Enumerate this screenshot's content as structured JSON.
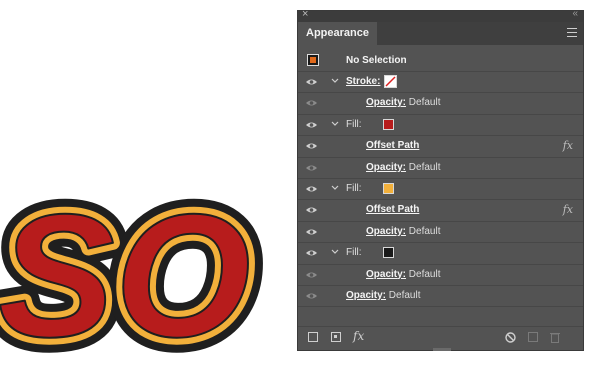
{
  "artwork": {
    "text": "SO",
    "colors": {
      "outer": "#1f1f1f",
      "gold": "#f2b03b",
      "red": "#b71c1c"
    }
  },
  "panel": {
    "title": "Appearance",
    "colors": {
      "bg": "#535353",
      "dark": "#3c3c3c",
      "text": "#ededed"
    },
    "selection": {
      "label": "No Selection"
    },
    "rows": {
      "stroke": {
        "label": "Stroke:"
      },
      "stroke_opacity": {
        "label": "Opacity:",
        "value": "Default"
      },
      "fill1": {
        "label": "Fill:",
        "swatch": "#b71c1c"
      },
      "fill1_effect": {
        "label": "Offset Path",
        "fx": "fx"
      },
      "fill1_opacity": {
        "label": "Opacity:",
        "value": "Default"
      },
      "fill2": {
        "label": "Fill:",
        "swatch": "#f2b03b"
      },
      "fill2_effect": {
        "label": "Offset Path",
        "fx": "fx"
      },
      "fill2_opacity": {
        "label": "Opacity:",
        "value": "Default"
      },
      "fill3": {
        "label": "Fill:",
        "swatch": "#1a1a1a"
      },
      "fill3_opacity": {
        "label": "Opacity:",
        "value": "Default"
      },
      "opacity": {
        "label": "Opacity:",
        "value": "Default"
      }
    },
    "toolbar": {
      "icons": [
        "new-stroke-icon",
        "new-fill-icon",
        "fx-menu-icon",
        "clear-appearance-icon",
        "duplicate-icon",
        "delete-icon"
      ],
      "fx_label": "fx"
    }
  }
}
